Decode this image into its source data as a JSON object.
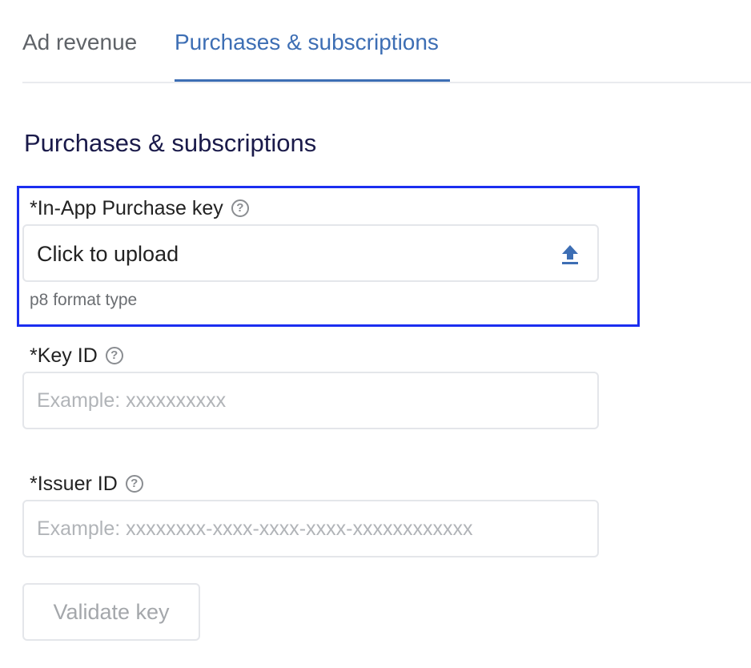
{
  "tabs": [
    {
      "label": "Ad revenue",
      "active": false
    },
    {
      "label": "Purchases & subscriptions",
      "active": true
    }
  ],
  "section": {
    "title": "Purchases & subscriptions"
  },
  "iap_key": {
    "label": "*In-App Purchase key",
    "upload_text": "Click to upload",
    "hint": "p8 format type",
    "icon": "upload-icon"
  },
  "key_id": {
    "label": "*Key ID",
    "placeholder": "Example: xxxxxxxxxx"
  },
  "issuer_id": {
    "label": "*Issuer ID",
    "placeholder": "Example: xxxxxxxx-xxxx-xxxx-xxxx-xxxxxxxxxxxx"
  },
  "validate_button": {
    "label": "Validate key"
  },
  "help_icon": "?",
  "colors": {
    "accent": "#3d6eb4",
    "highlight": "#1b2ef0",
    "title": "#1a1a4a"
  }
}
